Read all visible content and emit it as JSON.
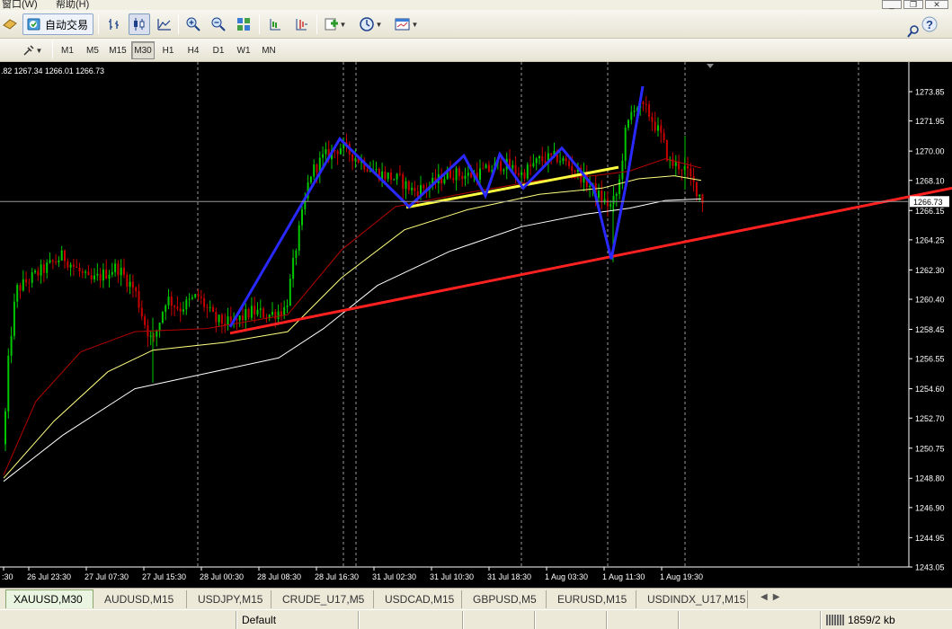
{
  "menu": {
    "items": [
      "窗口(W)",
      "帮助(H)"
    ]
  },
  "toolbar": {
    "autotrade_label": "自动交易",
    "timeframes": [
      "M1",
      "M5",
      "M15",
      "M30",
      "H1",
      "H4",
      "D1",
      "W1",
      "MN"
    ],
    "active_timeframe": "M30"
  },
  "chart": {
    "ohlc_text": ".82 1267.34 1266.01 1266.73",
    "current_price_label": "1266.73",
    "price_levels": [
      "1273.85",
      "1271.95",
      "1270.00",
      "1268.10",
      "1266.15",
      "1264.25",
      "1262.30",
      "1260.40",
      "1258.45",
      "1256.55",
      "1254.60",
      "1252.70",
      "1250.75",
      "1248.80",
      "1246.90",
      "1244.95",
      "1243.05"
    ],
    "time_labels": [
      ":30",
      "26 Jul 23:30",
      "27 Jul 07:30",
      "27 Jul 15:30",
      "28 Jul 00:30",
      "28 Jul 08:30",
      "28 Jul 16:30",
      "31 Jul 02:30",
      "31 Jul 10:30",
      "31 Jul 18:30",
      "1 Aug 03:30",
      "1 Aug 11:30",
      "1 Aug 19:30"
    ],
    "colors": {
      "background": "#000000",
      "bull_candle": "#00c800",
      "bear_candle": "#c80000",
      "ma_fast": "#b40000",
      "ma_mid": "#ffff80",
      "ma_slow": "#ffffff",
      "trend_line": "#ff2020",
      "pattern_line": "#2828ff",
      "neckline": "#ffff40"
    },
    "chart_data": {
      "type": "candlestick",
      "symbol": "XAUUSD",
      "timeframe": "M30",
      "y_range": [
        1243.05,
        1275.0
      ],
      "grid": "vertical dashed at session breaks",
      "approx_close_path": [
        {
          "x": "26 Jul 23:30",
          "y": 1261.0
        },
        {
          "x": "27 Jul 07:30",
          "y": 1262.8
        },
        {
          "x": "27 Jul 15:30",
          "y": 1258.0
        },
        {
          "x": "28 Jul 00:30",
          "y": 1259.5
        },
        {
          "x": "28 Jul 08:30",
          "y": 1259.2
        },
        {
          "x": "28 Jul 16:30",
          "y": 1270.2
        },
        {
          "x": "31 Jul 02:30",
          "y": 1267.5
        },
        {
          "x": "31 Jul 10:30",
          "y": 1268.0
        },
        {
          "x": "31 Jul 18:30",
          "y": 1269.5
        },
        {
          "x": "1 Aug 03:30",
          "y": 1268.5
        },
        {
          "x": "1 Aug 11:30",
          "y": 1273.2
        },
        {
          "x": "1 Aug 19:30",
          "y": 1266.7
        }
      ]
    }
  },
  "tabs": [
    "XAUUSD,M30",
    "AUDUSD,M15",
    "USDJPY,M15",
    "CRUDE_U17,M5",
    "USDCAD,M15",
    "GBPUSD,M5",
    "EURUSD,M15",
    "USDINDX_U17,M15"
  ],
  "active_tab": 0,
  "status": {
    "profile": "Default",
    "traffic": "1859/2 kb"
  }
}
